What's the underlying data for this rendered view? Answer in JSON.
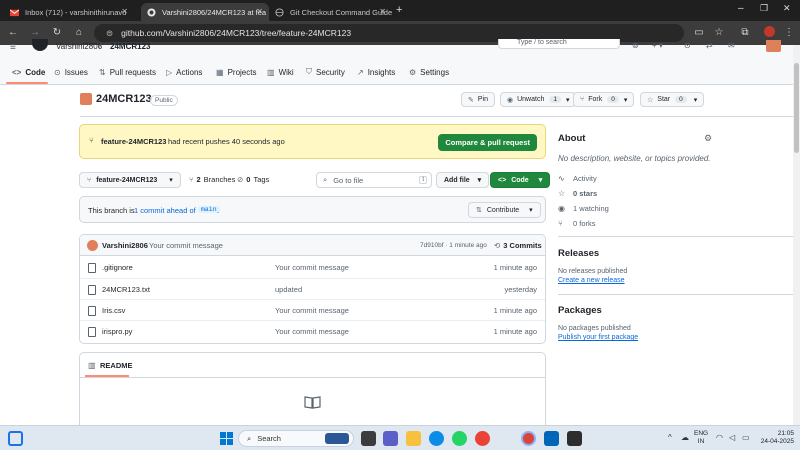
{
  "browser": {
    "tabs": [
      {
        "title": "Inbox (712) - varshinithirunavu"
      },
      {
        "title": "Varshini2806/24MCR123 at fea"
      },
      {
        "title": "Git Checkout Command Guide"
      }
    ],
    "url": "github.com/Varshini2806/24MCR123/tree/feature-24MCR123"
  },
  "header": {
    "owner": "Varshini2806",
    "slash": "/",
    "repo_short": "24MCR123",
    "search_placeholder": "Type / to search"
  },
  "repo_nav": [
    {
      "label": "Code",
      "icon": "code-icon"
    },
    {
      "label": "Issues",
      "icon": "issue-icon"
    },
    {
      "label": "Pull requests",
      "icon": "pull-request-icon"
    },
    {
      "label": "Actions",
      "icon": "play-icon"
    },
    {
      "label": "Projects",
      "icon": "table-icon"
    },
    {
      "label": "Wiki",
      "icon": "book-icon"
    },
    {
      "label": "Security",
      "icon": "shield-icon"
    },
    {
      "label": "Insights",
      "icon": "graph-icon"
    },
    {
      "label": "Settings",
      "icon": "gear-icon"
    }
  ],
  "repo": {
    "name": "24MCR123",
    "visibility": "Public",
    "pin_label": "Pin",
    "watch_label": "Unwatch",
    "watch_count": "1",
    "fork_label": "Fork",
    "fork_count": "0",
    "star_label": "Star",
    "star_count": "0"
  },
  "banner": {
    "branch": "feature-24MCR123",
    "text": "had recent pushes 40 seconds ago",
    "button": "Compare & pull request"
  },
  "branch_bar": {
    "branch": "feature-24MCR123",
    "branches_count": "2",
    "branches_label": "Branches",
    "tags_count": "0",
    "tags_label": "Tags",
    "goto_placeholder": "Go to file",
    "goto_key": "t",
    "add_file": "Add file",
    "code_button": "Code"
  },
  "ahead": {
    "prefix": "This branch is",
    "link": "1 commit ahead of",
    "base": "main",
    "suffix": ".",
    "contribute": "Contribute"
  },
  "latest_commit": {
    "author": "Varshini2806",
    "message": "Your commit message",
    "meta": "7d910bf · 1 minute ago",
    "commits": "3 Commits"
  },
  "files": [
    {
      "name": ".gitignore",
      "message": "Your commit message",
      "time": "1 minute ago"
    },
    {
      "name": "24MCR123.txt",
      "message": "updated",
      "time": "yesterday"
    },
    {
      "name": "Iris.csv",
      "message": "Your commit message",
      "time": "1 minute ago"
    },
    {
      "name": "irispro.py",
      "message": "Your commit message",
      "time": "1 minute ago"
    }
  ],
  "readme": {
    "label": "README"
  },
  "about": {
    "title": "About",
    "description": "No description, website, or topics provided.",
    "activity": "Activity",
    "stars": "0 stars",
    "watching": "1 watching",
    "forks": "0 forks"
  },
  "releases": {
    "title": "Releases",
    "text": "No releases published",
    "link": "Create a new release"
  },
  "packages": {
    "title": "Packages",
    "text": "No packages published",
    "link": "Publish your first package"
  },
  "taskbar": {
    "search": "Search",
    "lang_top": "ENG",
    "lang_bottom": "IN",
    "time": "21:05",
    "date": "24-04-2025"
  },
  "colors": {
    "accent_green": "#1f883d",
    "link_blue": "#0969da",
    "banner_yellow": "#fff8c5",
    "nav_underline": "#fd8c73"
  }
}
